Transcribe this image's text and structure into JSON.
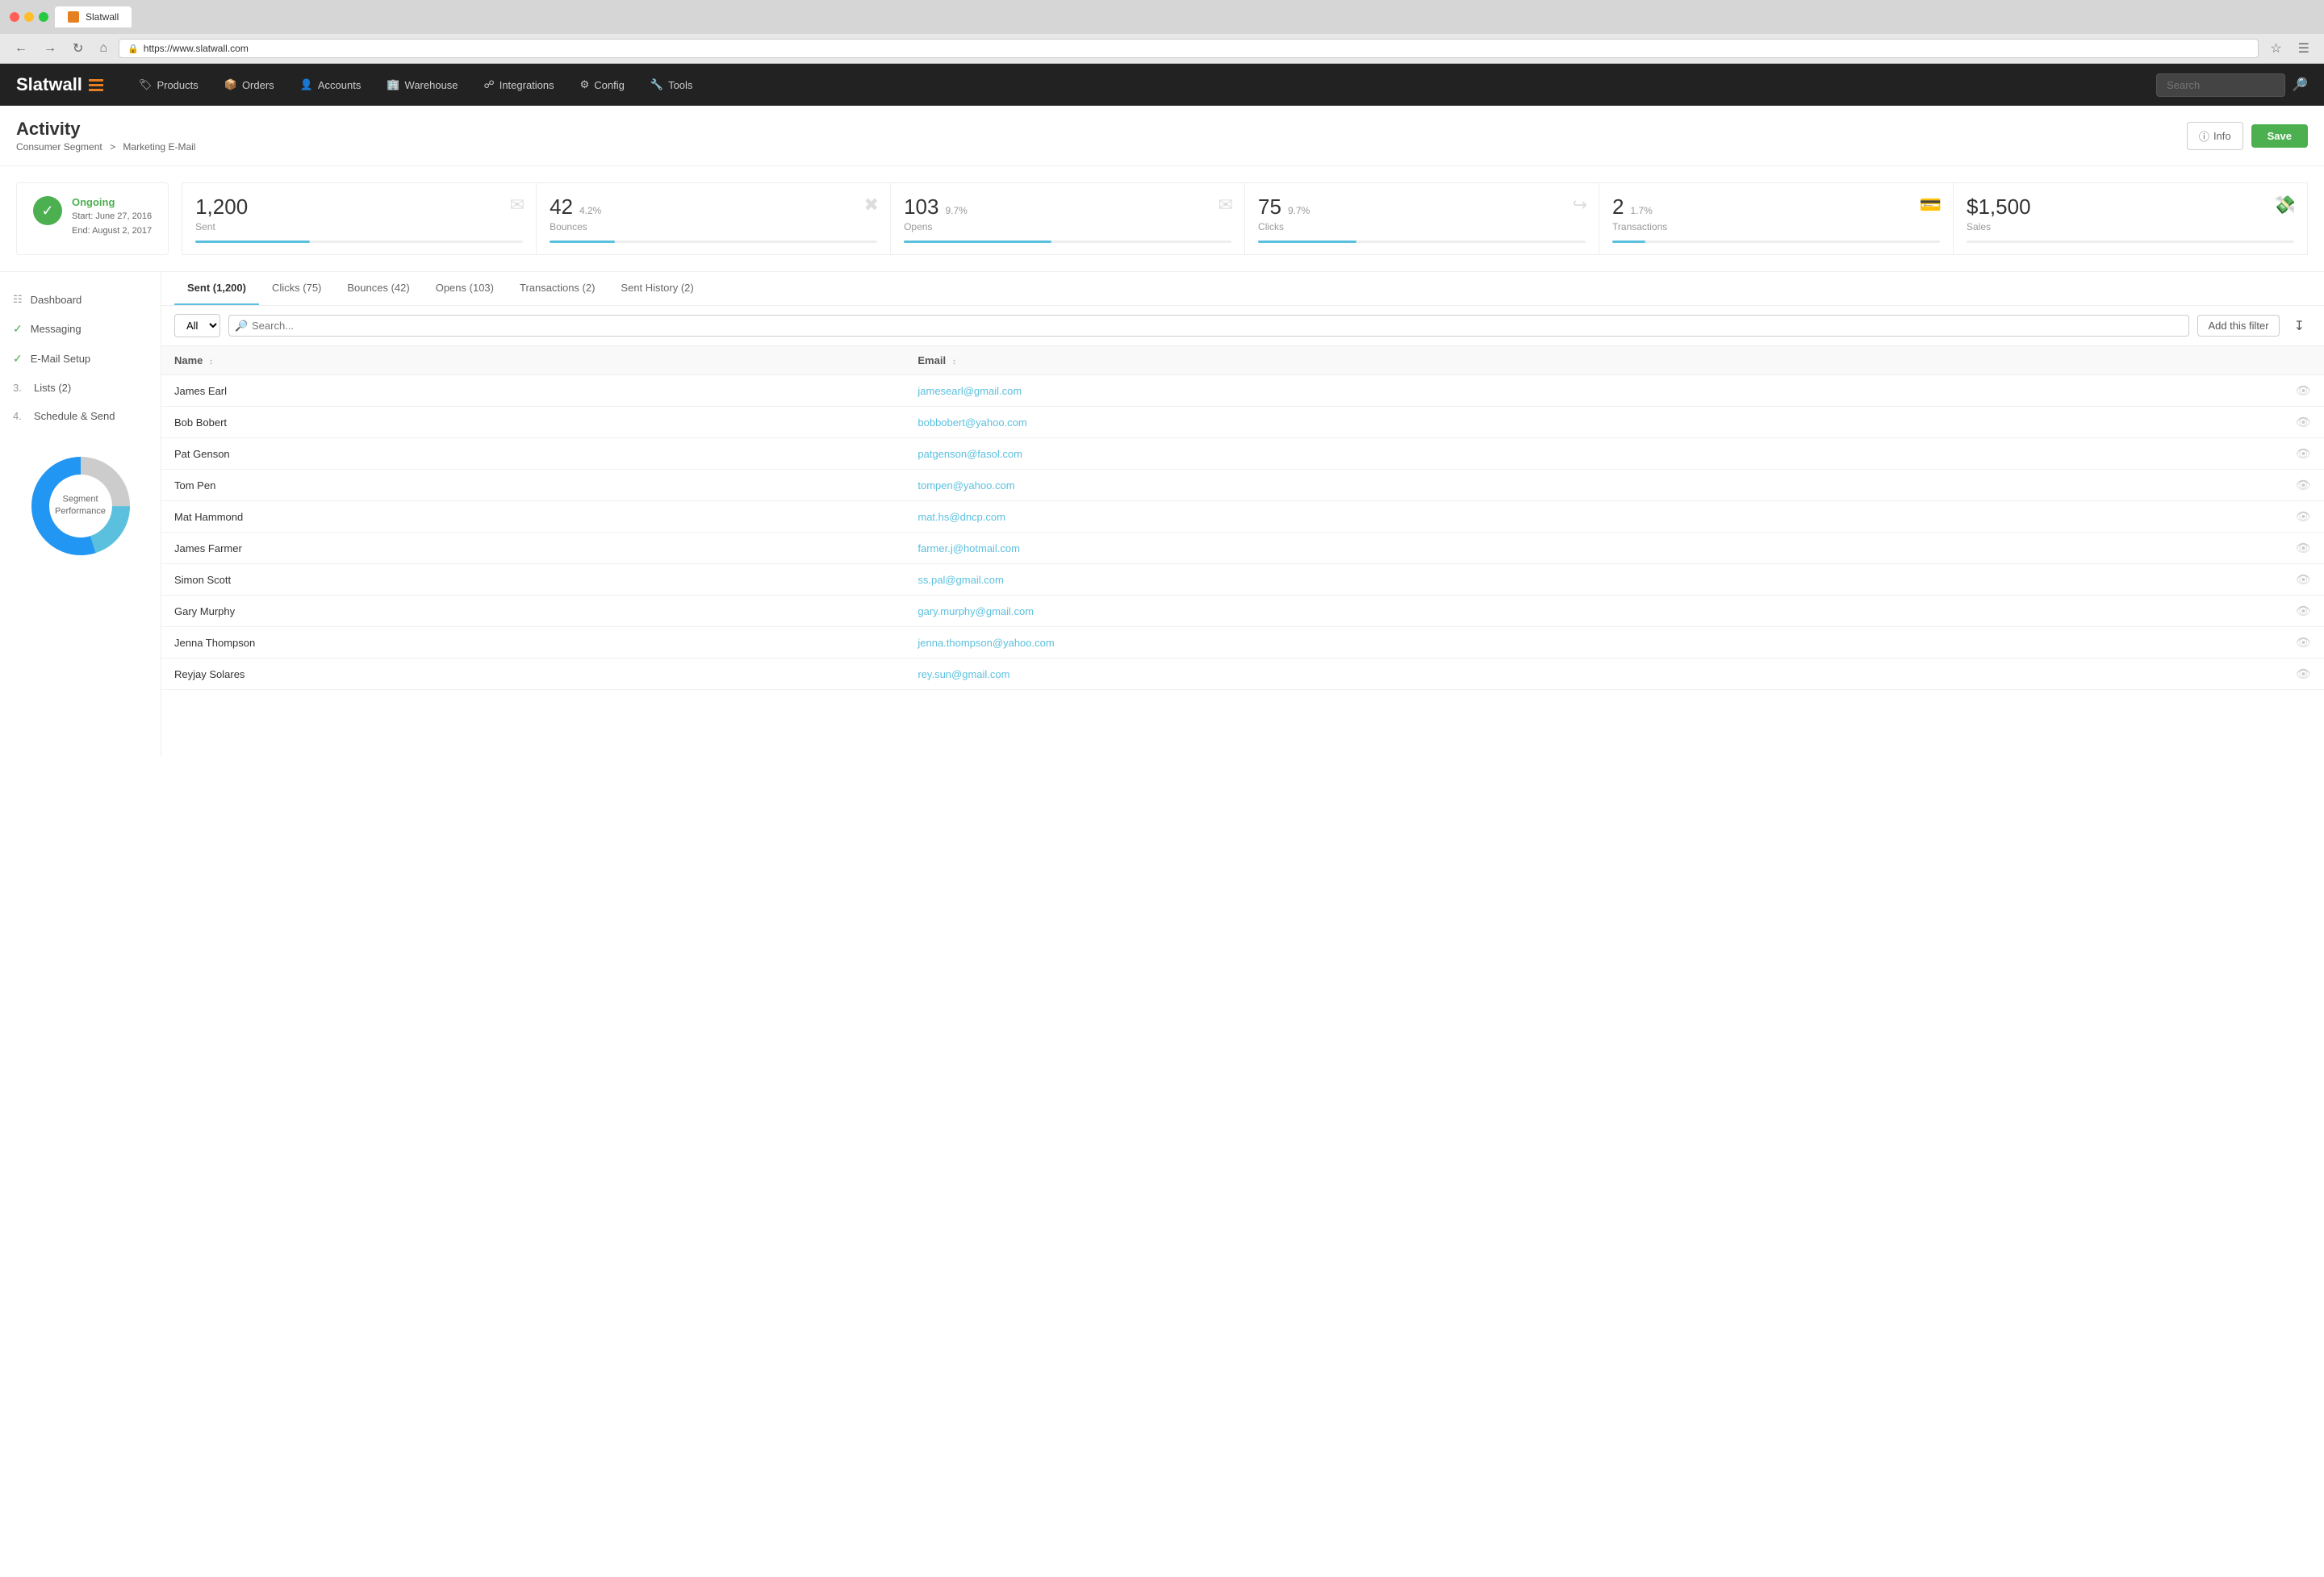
{
  "browser": {
    "url": "https://www.slatwall.com",
    "tab_title": "Slatwall",
    "search_placeholder": "Search"
  },
  "nav": {
    "logo": "Slatwall",
    "items": [
      {
        "label": "Products",
        "icon": "tag"
      },
      {
        "label": "Orders",
        "icon": "box"
      },
      {
        "label": "Accounts",
        "icon": "person"
      },
      {
        "label": "Warehouse",
        "icon": "warehouse"
      },
      {
        "label": "Integrations",
        "icon": "connect"
      },
      {
        "label": "Config",
        "icon": "gear"
      },
      {
        "label": "Tools",
        "icon": "tools"
      }
    ],
    "search_placeholder": "Search"
  },
  "page": {
    "title": "Activity",
    "breadcrumb_parent": "Consumer Segment",
    "breadcrumb_current": "Marketing E-Mail",
    "btn_info": "Info",
    "btn_save": "Save"
  },
  "status": {
    "label": "Ongoing",
    "start": "Start: June 27, 2016",
    "end": "End: August 2, 2017"
  },
  "stats": [
    {
      "value": "1,200",
      "pct": "",
      "label": "Sent",
      "bar_pct": 35
    },
    {
      "value": "42",
      "pct": "4.2%",
      "label": "Bounces",
      "bar_pct": 20
    },
    {
      "value": "103",
      "pct": "9.7%",
      "label": "Opens",
      "bar_pct": 45
    },
    {
      "value": "75",
      "pct": "9.7%",
      "label": "Clicks",
      "bar_pct": 30
    },
    {
      "value": "2",
      "pct": "1.7%",
      "label": "Transactions",
      "bar_pct": 10
    },
    {
      "value": "$1,500",
      "pct": "",
      "label": "Sales",
      "bar_pct": 0
    }
  ],
  "sidebar": {
    "items": [
      {
        "type": "icon",
        "label": "Dashboard",
        "icon": "grid"
      },
      {
        "type": "check",
        "label": "Messaging"
      },
      {
        "type": "check",
        "label": "E-Mail Setup"
      },
      {
        "type": "num",
        "num": "3.",
        "label": "Lists (2)"
      },
      {
        "type": "num",
        "num": "4.",
        "label": "Schedule & Send"
      }
    ],
    "chart_label": "Segment Performance"
  },
  "tabs": [
    {
      "label": "Sent (1,200)",
      "active": true
    },
    {
      "label": "Clicks (75)",
      "active": false
    },
    {
      "label": "Bounces (42)",
      "active": false
    },
    {
      "label": "Opens (103)",
      "active": false
    },
    {
      "label": "Transactions (2)",
      "active": false
    },
    {
      "label": "Sent History (2)",
      "active": false
    }
  ],
  "filter": {
    "all_label": "All",
    "search_placeholder": "Search...",
    "add_filter_label": "Add this filter"
  },
  "table": {
    "columns": [
      "Name",
      "Email"
    ],
    "rows": [
      {
        "name": "James Earl",
        "email": "jamesearl@gmail.com"
      },
      {
        "name": "Bob Bobert",
        "email": "bobbobert@yahoo.com"
      },
      {
        "name": "Pat Genson",
        "email": "patgenson@fasol.com"
      },
      {
        "name": "Tom Pen",
        "email": "tompen@yahoo.com"
      },
      {
        "name": "Mat Hammond",
        "email": "mat.hs@dncp.com"
      },
      {
        "name": "James Farmer",
        "email": "farmer.j@hotmail.com"
      },
      {
        "name": "Simon Scott",
        "email": "ss.pal@gmail.com"
      },
      {
        "name": "Gary Murphy",
        "email": "gary.murphy@gmail.com"
      },
      {
        "name": "Jenna Thompson",
        "email": "jenna.thompson@yahoo.com"
      },
      {
        "name": "Reyjay Solares",
        "email": "rey.sun@gmail.com"
      }
    ]
  },
  "donut": {
    "segments": [
      {
        "color": "#2196f3",
        "pct": 55
      },
      {
        "color": "#5bc0de",
        "pct": 20
      },
      {
        "color": "#ccc",
        "pct": 25
      }
    ]
  }
}
